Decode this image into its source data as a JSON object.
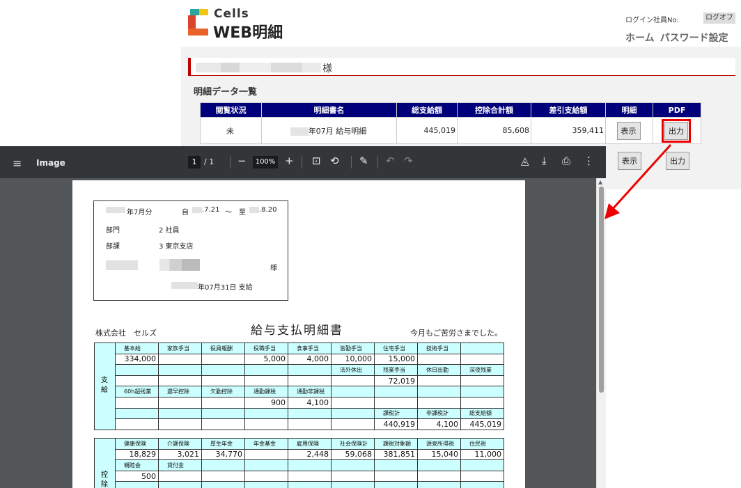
{
  "app": {
    "logo_top": "Cells",
    "logo_bottom": "WEB明細",
    "login_label": "ログイン社員No:",
    "logout": "ログオフ",
    "nav": [
      "ホーム",
      "パスワード設定"
    ]
  },
  "colors": {
    "accent_red": "#bb0000",
    "header_navy": "#00007a",
    "cell_cyan": "#ccffff",
    "viewer_bg": "#525659",
    "toolbar_bg": "#323639"
  },
  "greeting": {
    "suffix": "様"
  },
  "list": {
    "title": "明細データ一覧",
    "headers": [
      "閲覧状況",
      "明細書名",
      "総支給額",
      "控除合計額",
      "差引支給額",
      "明細",
      "PDF"
    ],
    "rows": [
      {
        "status": "未",
        "name": "年07月 給与明細",
        "gross": "445,019",
        "deduct": "85,608",
        "net": "359,411",
        "view": "表示",
        "pdf": "出力"
      }
    ],
    "row2": {
      "view": "表示",
      "pdf": "出力"
    }
  },
  "viewer": {
    "menu_icon": "hamburger-icon",
    "title": "Image",
    "page_current": "1",
    "page_sep": "/",
    "page_total": "1",
    "zoom": "100%",
    "icons": [
      "zoom-out-icon",
      "zoom-in-icon",
      "fit-page-icon",
      "rotate-icon",
      "annotate-icon",
      "undo-icon",
      "redo-icon",
      "drive-icon",
      "download-icon",
      "print-icon",
      "more-icon"
    ],
    "glyphs": {
      "minus": "−",
      "plus": "+",
      "fit": "⊡",
      "rotate": "⟲",
      "pen": "✎",
      "undo": "↶",
      "redo": "↷",
      "drive": "◬",
      "download": "⤓",
      "print": "⎙",
      "more": "⋮",
      "menu": "≡",
      "up": "▲"
    }
  },
  "doc": {
    "period": "年7月分",
    "from_label": "自",
    "from_val": ".7.21",
    "tilde": "〜",
    "to_label": "至",
    "to_val": ".8.20",
    "dept_label": "部門",
    "dept_val": "2 社員",
    "section_label": "部課",
    "section_val": "3 東京支店",
    "sama": "様",
    "pay_date": "年07月31日 支給",
    "company": "株式会社　セルズ",
    "heading": "給与支払明細書",
    "greeting": "今月もご苦労さまでした。",
    "payments_side": "支\n給",
    "deductions_side": "控\n除",
    "pay_rows": [
      [
        "基本給",
        "家族手当",
        "役員報酬",
        "役職手当",
        "食事手当",
        "皆勤手当",
        "住宅手当",
        "技術手当",
        ""
      ],
      [
        "334,000",
        "",
        "",
        "5,000",
        "4,000",
        "10,000",
        "15,000",
        "",
        ""
      ],
      [
        "",
        "",
        "",
        "",
        "",
        "法外休出",
        "残業手当",
        "休日出勤",
        "深夜残業"
      ],
      [
        "",
        "",
        "",
        "",
        "",
        "",
        "72,019",
        "",
        ""
      ],
      [
        "60h超残業",
        "遅早控除",
        "欠勤控除",
        "通勤課税",
        "通勤非課税",
        "",
        "",
        "",
        ""
      ],
      [
        "",
        "",
        "",
        "900",
        "4,100",
        "",
        "",
        "",
        ""
      ],
      [
        "",
        "",
        "",
        "",
        "",
        "",
        "課税計",
        "非課税計",
        "総支給額"
      ],
      [
        "",
        "",
        "",
        "",
        "",
        "",
        "440,919",
        "4,100",
        "445,019"
      ]
    ],
    "ded_rows": [
      [
        "健康保険",
        "介護保険",
        "厚生年金",
        "年金基金",
        "雇用保険",
        "社会保険計",
        "課税対象額",
        "源泉所得税",
        "住民税"
      ],
      [
        "18,829",
        "3,021",
        "34,770",
        "",
        "2,448",
        "59,068",
        "381,851",
        "15,040",
        "11,000"
      ],
      [
        "親睦会",
        "貸付金",
        "",
        "",
        "",
        "",
        "",
        "",
        ""
      ],
      [
        "500",
        "",
        "",
        "",
        "",
        "",
        "",
        "",
        ""
      ],
      [
        "",
        "",
        "",
        "",
        "",
        "",
        "",
        "",
        ""
      ]
    ]
  }
}
